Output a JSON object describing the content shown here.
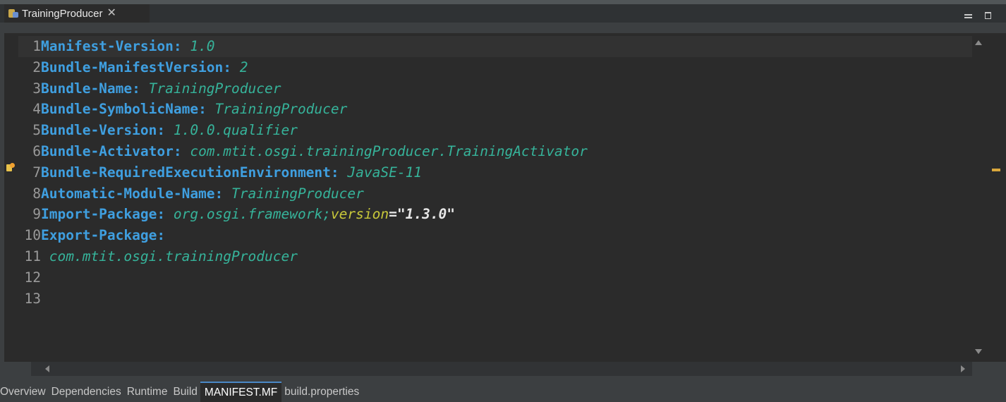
{
  "tab": {
    "title": "TrainingProducer",
    "icon": "plugin-manifest-icon",
    "close_glyph": "✕"
  },
  "editor": {
    "lines": [
      {
        "num": "1",
        "key": "Manifest-Version",
        "sep": ": ",
        "value": "1.0"
      },
      {
        "num": "2",
        "key": "Bundle-ManifestVersion",
        "sep": ": ",
        "value": "2"
      },
      {
        "num": "3",
        "key": "Bundle-Name",
        "sep": ": ",
        "value": "TrainingProducer"
      },
      {
        "num": "4",
        "key": "Bundle-SymbolicName",
        "sep": ": ",
        "value": "TrainingProducer"
      },
      {
        "num": "5",
        "key": "Bundle-Version",
        "sep": ": ",
        "value": "1.0.0.qualifier"
      },
      {
        "num": "6",
        "key": "Bundle-Activator",
        "sep": ": ",
        "value": "com.mtit.osgi.trainingProducer.TrainingActivator"
      },
      {
        "num": "7",
        "key": "Bundle-RequiredExecutionEnvironment",
        "sep": ": ",
        "value": "JavaSE-11"
      },
      {
        "num": "8",
        "key": "Automatic-Module-Name",
        "sep": ": ",
        "value": "TrainingProducer"
      },
      {
        "num": "9",
        "key": "Import-Package",
        "sep": ": ",
        "value": "org.osgi.framework;",
        "attr": "version",
        "eq": "=",
        "str": "\"1.3.0\""
      },
      {
        "num": "10",
        "key": "Export-Package",
        "sep": ":",
        "value": ""
      },
      {
        "num": "11",
        "key": "",
        "sep": "",
        "value": " com.mtit.osgi.trainingProducer"
      },
      {
        "num": "12",
        "key": "",
        "sep": "",
        "value": ""
      },
      {
        "num": "13",
        "key": "",
        "sep": "",
        "value": ""
      }
    ],
    "warning_line": "7"
  },
  "bottom_tabs": [
    {
      "label": "Overview",
      "active": false
    },
    {
      "label": "Dependencies",
      "active": false
    },
    {
      "label": "Runtime",
      "active": false
    },
    {
      "label": "Build",
      "active": false
    },
    {
      "label": "MANIFEST.MF",
      "active": true
    },
    {
      "label": "build.properties",
      "active": false
    }
  ],
  "colors": {
    "background": "#2b2b2b",
    "key": "#3f9fe0",
    "value": "#36b39a",
    "attribute": "#c8c83a",
    "warning": "#d9a73c"
  }
}
